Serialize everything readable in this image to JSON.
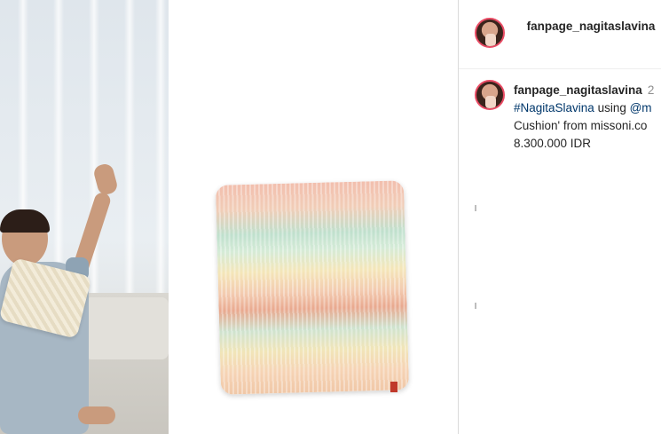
{
  "post": {
    "header_username": "fanpage_nagitaslavina",
    "caption_username": "fanpage_nagitaslavina",
    "caption_time": "2",
    "caption_hashtag": "#NagitaSlavina",
    "caption_text_1": " using ",
    "caption_mention": "@m",
    "caption_line_2": "Cushion' from missoni.co",
    "caption_line_3": "8.300.000 IDR"
  },
  "colors": {
    "link": "#00376b",
    "text": "#262626",
    "avatar_ring": "#e94b64"
  }
}
